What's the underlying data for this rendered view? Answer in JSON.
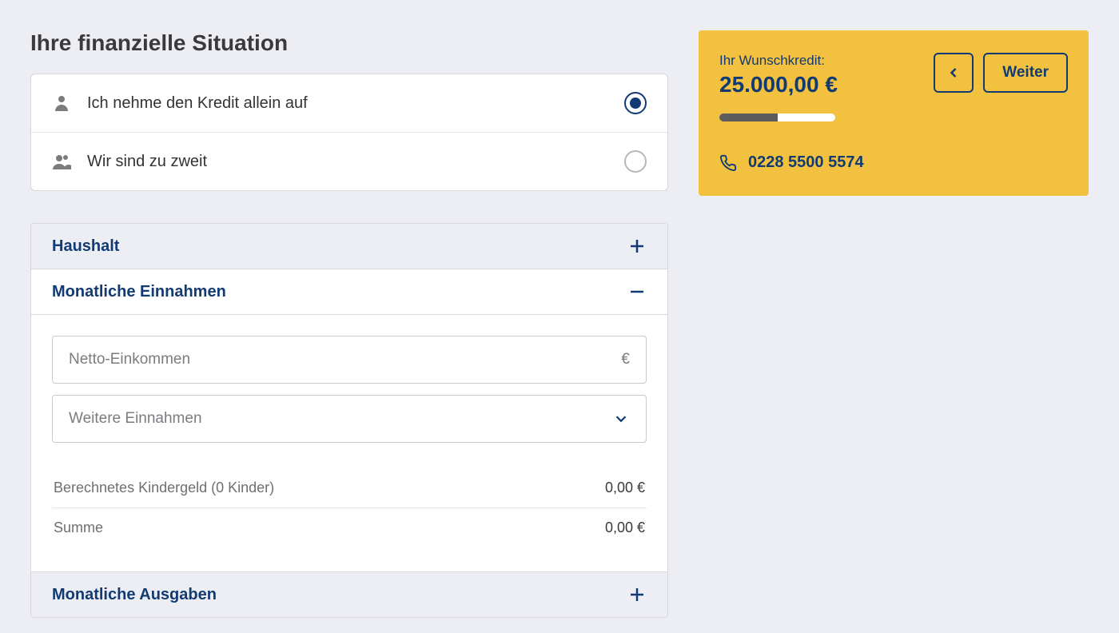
{
  "page": {
    "title": "Ihre finanzielle Situation"
  },
  "radios": {
    "alone": "Ich nehme den Kredit allein auf",
    "together": "Wir sind zu zweit"
  },
  "accordion": {
    "household": "Haushalt",
    "income": "Monatliche Einnahmen",
    "expenses": "Monatliche Ausgaben"
  },
  "income": {
    "netto_placeholder": "Netto-Einkommen",
    "currency": "€",
    "additional_placeholder": "Weitere Einnahmen",
    "kindergeld_label": "Berechnetes Kindergeld (0 Kinder)",
    "kindergeld_value": "0,00 €",
    "sum_label": "Summe",
    "sum_value": "0,00 €"
  },
  "sidebar": {
    "credit_label": "Ihr Wunschkredit:",
    "credit_amount": "25.000,00 €",
    "next_label": "Weiter",
    "phone": "0228 5500 5574"
  }
}
